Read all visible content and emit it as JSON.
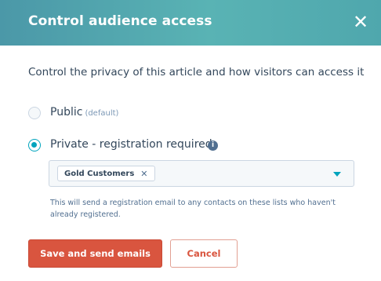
{
  "modal": {
    "title": "Control audience access",
    "close_glyph": "✕",
    "close_icon": "close-icon"
  },
  "description": "Control the privacy of this article and how visitors can access it",
  "options": [
    {
      "label": "Public",
      "sub": "(default)",
      "selected": false
    },
    {
      "label": "Private - registration required",
      "selected": true,
      "info_glyph": "i",
      "info_icon": "info-icon"
    }
  ],
  "list_select": {
    "tags": [
      {
        "label": "Gold Customers",
        "remove_glyph": "✕"
      }
    ],
    "caret_icon": "chevron-down-icon"
  },
  "help_text": "This will send a registration email to any contacts on these lists who haven't already registered.",
  "buttons": {
    "primary": "Save and send emails",
    "secondary": "Cancel"
  },
  "colors": {
    "header_gradient_start": "#4b98a8",
    "header_gradient_end": "#59b3b4",
    "accent": "#00a4bd",
    "primary_button": "#d9553f",
    "text": "#33475b"
  }
}
